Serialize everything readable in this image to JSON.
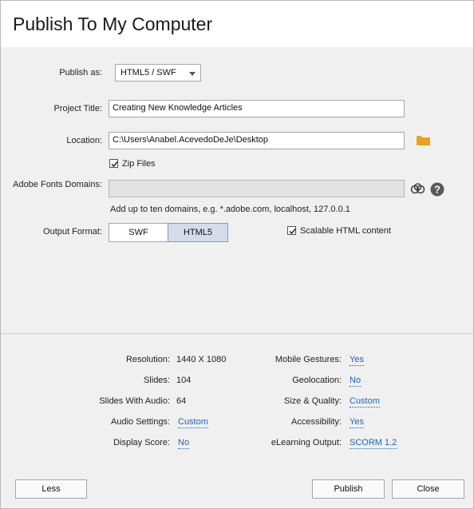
{
  "dialog": {
    "title": "Publish To My Computer"
  },
  "form": {
    "publish_as_label": "Publish as:",
    "publish_as_value": "HTML5 / SWF",
    "project_title_label": "Project Title:",
    "project_title_value": "Creating New Knowledge Articles",
    "location_label": "Location:",
    "location_value": "C:\\Users\\Anabel.AcevedoDeJe\\Desktop",
    "zip_files_label": "Zip Files",
    "zip_files_checked": true,
    "fonts_domains_label": "Adobe Fonts Domains:",
    "fonts_domains_value": "",
    "fonts_domains_hint": "Add up to ten domains, e.g. *.adobe.com, localhost, 127.0.0.1",
    "output_format_label": "Output Format:",
    "output_format_options": [
      "SWF",
      "HTML5"
    ],
    "output_format_selected": "HTML5",
    "scalable_label": "Scalable HTML content",
    "scalable_checked": true
  },
  "summary": {
    "left": [
      {
        "label": "Resolution:",
        "value": "1440 X 1080",
        "link": false
      },
      {
        "label": "Slides:",
        "value": "104",
        "link": false
      },
      {
        "label": "Slides With Audio:",
        "value": "64",
        "link": false
      },
      {
        "label": "Audio Settings:",
        "value": "Custom",
        "link": true
      },
      {
        "label": "Display Score:",
        "value": "No",
        "link": true
      }
    ],
    "right": [
      {
        "label": "Mobile Gestures:",
        "value": "Yes",
        "link": true
      },
      {
        "label": "Geolocation:",
        "value": "No",
        "link": true
      },
      {
        "label": "Size & Quality:",
        "value": "Custom",
        "link": true
      },
      {
        "label": "Accessibility:",
        "value": "Yes",
        "link": true
      },
      {
        "label": "eLearning Output:",
        "value": "SCORM 1.2",
        "link": true
      }
    ]
  },
  "buttons": {
    "less": "Less",
    "publish": "Publish",
    "close": "Close"
  },
  "colors": {
    "link": "#1a64c8",
    "folder": "#e8a317",
    "selected_segment": "#d4dcea"
  }
}
